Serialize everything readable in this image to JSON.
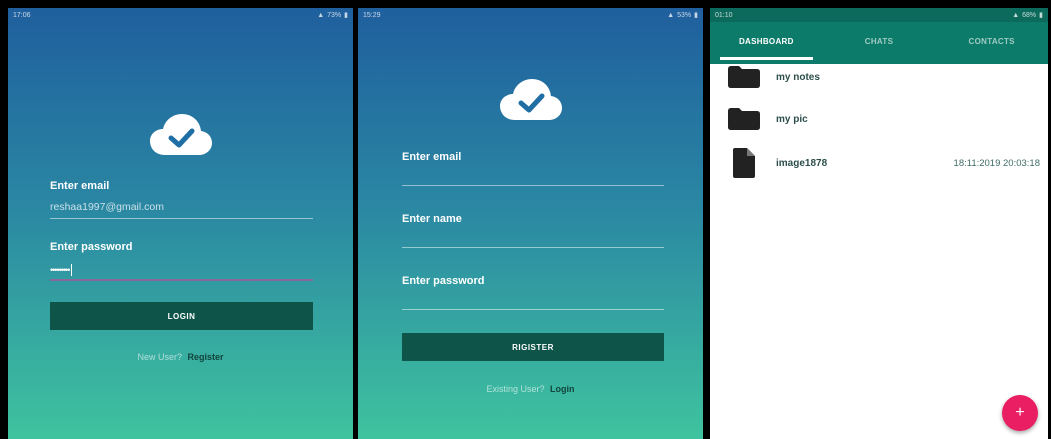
{
  "login_screen": {
    "status_time": "17:06",
    "status_right": "73%",
    "email_label": "Enter email",
    "email_value": "reshaa1997@gmail.com",
    "password_label": "Enter password",
    "password_value": "•••••••••",
    "login_button": "LOGIN",
    "new_user_text": "New User?",
    "register_link": "Register"
  },
  "register_screen": {
    "status_time": "15:29",
    "status_right": "53%",
    "email_label": "Enter email",
    "name_label": "Enter name",
    "password_label": "Enter password",
    "register_button": "RIGISTER",
    "existing_user_text": "Existing User?",
    "login_link": "Login"
  },
  "dashboard_screen": {
    "status_time": "01:10",
    "status_right": "68%",
    "tabs": [
      {
        "label": "DASHBOARD",
        "active": true
      },
      {
        "label": "CHATS",
        "active": false
      },
      {
        "label": "CONTACTS",
        "active": false
      }
    ],
    "items": [
      {
        "icon": "folder-icon",
        "label": "my notes",
        "time": ""
      },
      {
        "icon": "folder-icon",
        "label": "my pic",
        "time": ""
      },
      {
        "icon": "file-icon",
        "label": "image1878",
        "time": "18:11:2019 20:03:18"
      }
    ],
    "fab_label": "+"
  },
  "colors": {
    "gradient_top": "#1f5f9e",
    "gradient_bottom": "#3fc39f",
    "button": "#0e5448",
    "appbar": "#0d7b6a",
    "fab": "#e91e63"
  }
}
